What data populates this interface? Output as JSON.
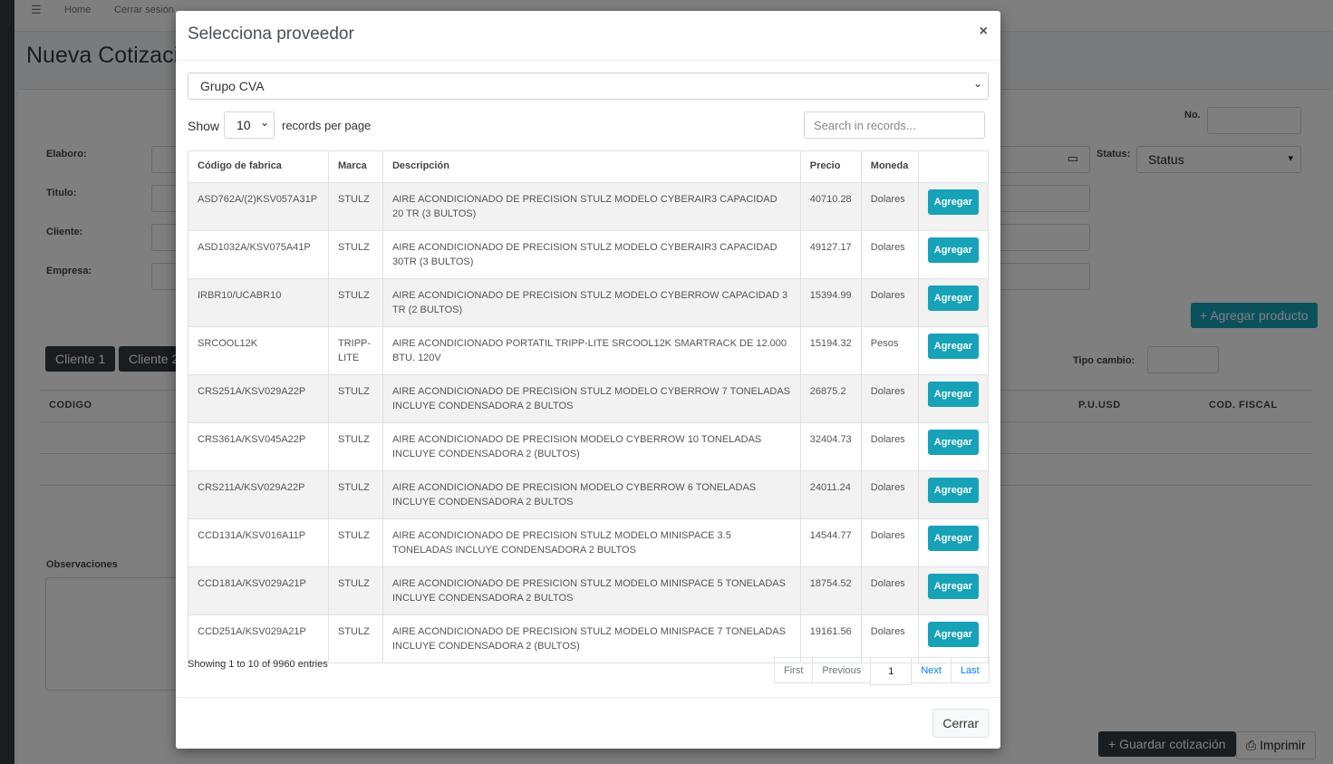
{
  "nav": {
    "menu_icon": "hamburger-icon",
    "home": "Home",
    "logout": "Cerrar sesión"
  },
  "page": {
    "title": "Nueva Cotización",
    "no_label": "No.",
    "elaboro_label": "Elaboro:",
    "titulo_label": "Titulo:",
    "cliente_label": "Cliente:",
    "empresa_label": "Empresa:",
    "status_label": "Status:",
    "status_value": "Status",
    "agregar_producto": "Agregar producto",
    "tipo_cambio_label": "Tipo cambio:",
    "cliente1": "Cliente 1",
    "cliente2": "Cliente 2",
    "col_codigo": "CODIGO",
    "col_pu_usd": "P.U.USD",
    "col_cod_fiscal": "COD. FISCAL",
    "observaciones": "Observaciones",
    "guardar": "Guardar cotización",
    "imprimir": "Imprimir"
  },
  "modal": {
    "title": "Selecciona proveedor",
    "close": "×",
    "provider": "Grupo CVA",
    "show_label": "Show",
    "page_length": "10",
    "records_per_page": "records per page",
    "search_placeholder": "Search in records...",
    "columns": [
      "Código de fabrica",
      "Marca",
      "Descripción",
      "Precio",
      "Moneda",
      ""
    ],
    "add_label": "Agregar",
    "rows": [
      [
        "ASD762A/(2)KSV057A31P",
        "STULZ",
        "AIRE ACONDICIONADO DE PRECISION STULZ MODELO CYBERAIR3 CAPACIDAD 20 TR (3 BULTOS)",
        "40710.28",
        "Dolares"
      ],
      [
        "ASD1032A/KSV075A41P",
        "STULZ",
        "AIRE ACONDICIONADO DE PRECISION STULZ MODELO CYBERAIR3 CAPACIDAD 30TR (3 BULTOS)",
        "49127.17",
        "Dolares"
      ],
      [
        "IRBR10/UCABR10",
        "STULZ",
        "AIRE ACONDICIONADO DE PRECISION STULZ MODELO CYBERROW CAPACIDAD 3 TR (2 BULTOS)",
        "15394.99",
        "Dolares"
      ],
      [
        "SRCOOL12K",
        "TRIPP-LITE",
        "AIRE ACONDICIONADO PORTATIL TRIPP-LITE SRCOOL12K SMARTRACK DE 12.000 BTU. 120V",
        "15194.32",
        "Pesos"
      ],
      [
        "CRS251A/KSV029A22P",
        "STULZ",
        "AIRE ACONDICIONADO DE PRECISION STULZ MODELO CYBERROW 7 TONELADAS INCLUYE CONDENSADORA 2 BULTOS",
        "26875.2",
        "Dolares"
      ],
      [
        "CRS361A/KSV045A22P",
        "STULZ",
        "AIRE ACONDICIONADO DE PRECISION MODELO CYBERROW 10 TONELADAS INCLUYE CONDENSADORA 2 (BULTOS)",
        "32404.73",
        "Dolares"
      ],
      [
        "CRS211A/KSV029A22P",
        "STULZ",
        "AIRE ACONDICIONADO DE PRECISION MODELO CYBERROW 6 TONELADAS INCLUYE CONDENSADORA 2 BULTOS",
        "24011.24",
        "Dolares"
      ],
      [
        "CCD131A/KSV016A11P",
        "STULZ",
        "AIRE ACONDICIONADO DE PRECISION STULZ MODELO MINISPACE 3.5 TONELADAS INCLUYE CONDENSADORA 2 BULTOS",
        "14544.77",
        "Dolares"
      ],
      [
        "CCD181A/KSV029A21P",
        "STULZ",
        "AIRE ACONDICIONADO DE PRESICION STULZ MODELO MINISPACE 5 TONELADAS INCLUYE CONDENSADORA 2 BULTOS",
        "18754.52",
        "Dolares"
      ],
      [
        "CCD251A/KSV029A21P",
        "STULZ",
        "AIRE ACONDICIONADO DE PRECISION STULZ MODELO MINISPACE 7 TONELADAS INCLUYE CONDENSADORA 2 (BULTOS)",
        "19161.56",
        "Dolares"
      ]
    ],
    "info": "Showing 1 to 10 of 9960 entries",
    "pagination": {
      "first": "First",
      "previous": "Previous",
      "current": "1",
      "next": "Next",
      "last": "Last"
    },
    "cerrar": "Cerrar"
  },
  "colors": {
    "accent": "#17a2b8",
    "dark": "#343a40",
    "link": "#007bff"
  }
}
